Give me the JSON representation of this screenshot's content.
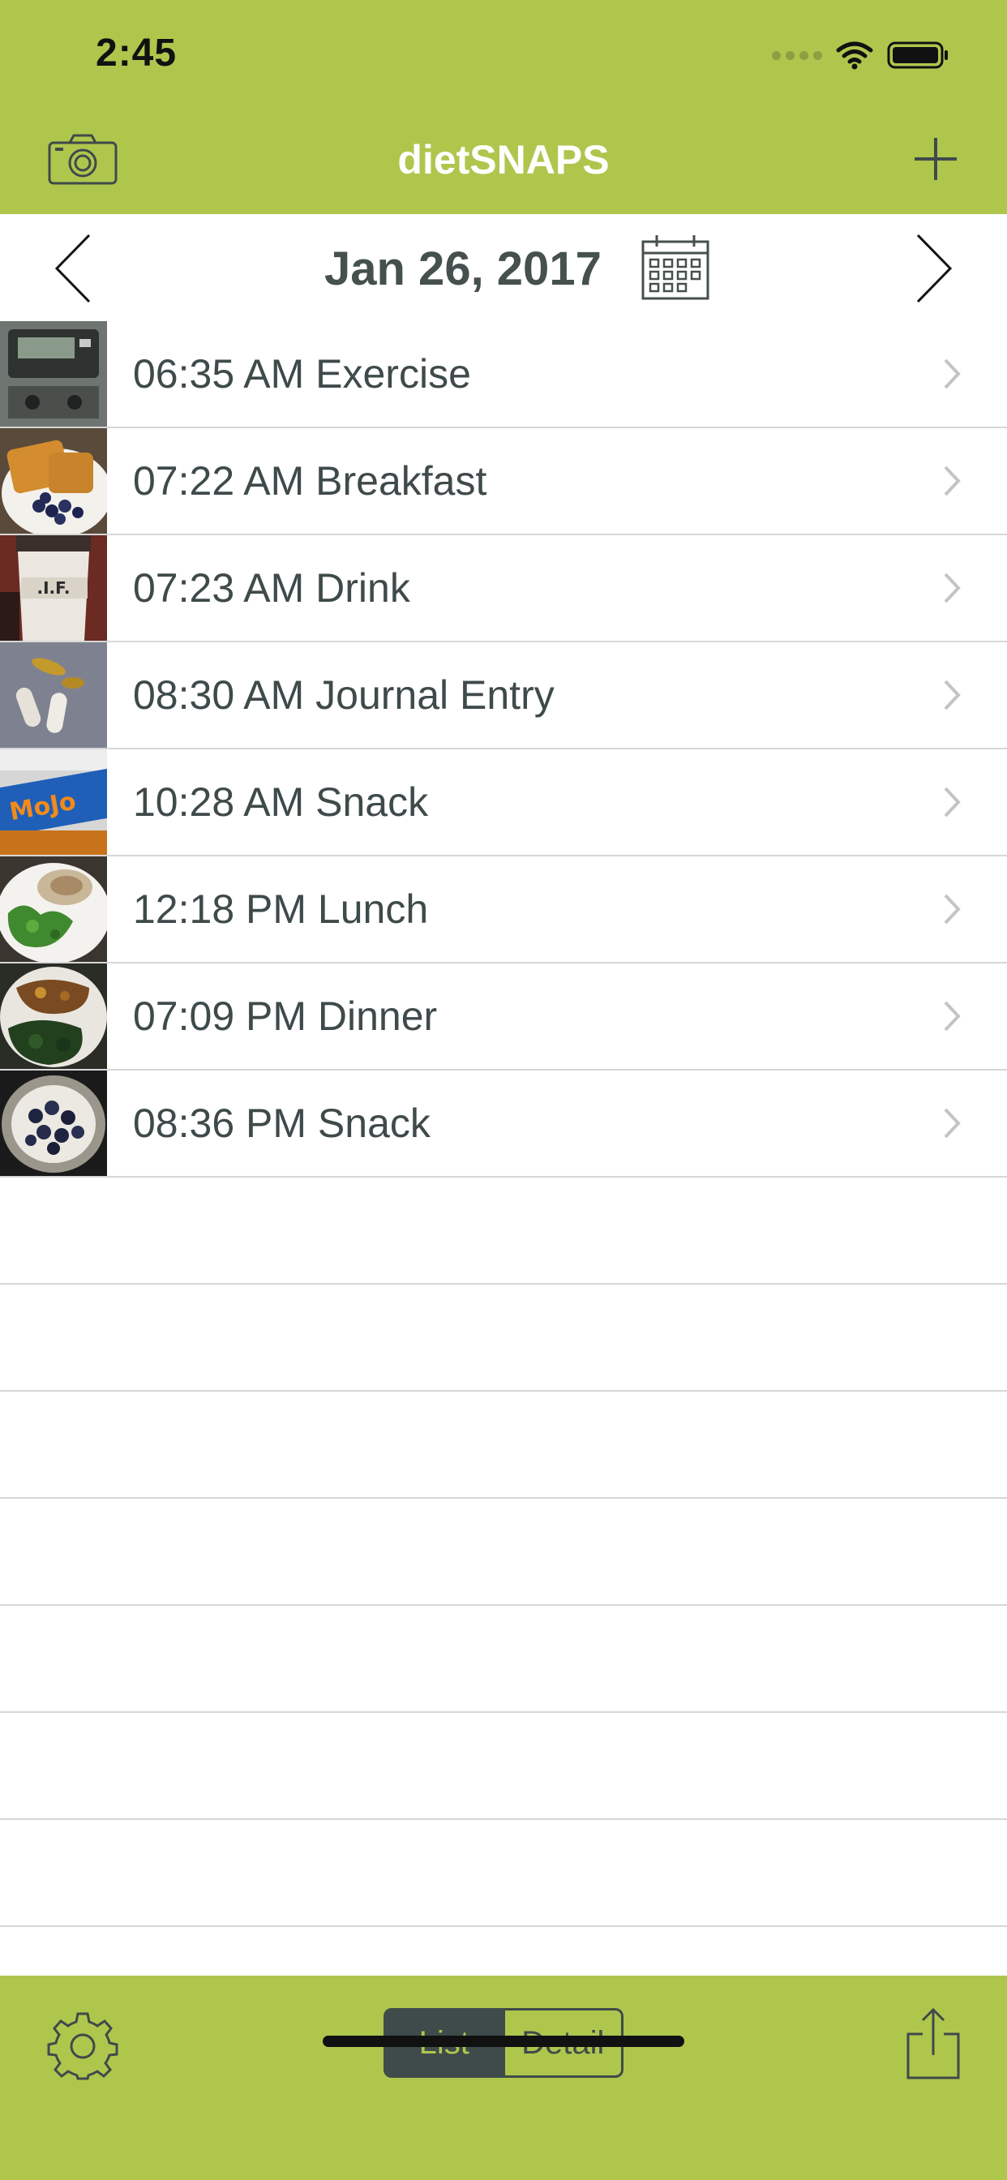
{
  "status_bar": {
    "time": "2:45",
    "icons": [
      "signal-dots-icon",
      "wifi-icon",
      "battery-icon"
    ]
  },
  "header": {
    "title": "dietSNAPS",
    "left_icon": "camera-icon",
    "right_icon": "plus-icon",
    "background_color": "#afc64d"
  },
  "date_bar": {
    "date": "Jan 26, 2017",
    "prev_icon": "chevron-left-icon",
    "next_icon": "chevron-right-icon",
    "calendar_icon": "calendar-icon"
  },
  "entries": [
    {
      "label": "06:35 AM Exercise",
      "thumbnail": "exercise-machine-photo"
    },
    {
      "label": "07:22 AM Breakfast",
      "thumbnail": "bread-and-blueberries-photo"
    },
    {
      "label": "07:23 AM Drink",
      "thumbnail": "coffee-cup-photo"
    },
    {
      "label": "08:30 AM Journal Entry",
      "thumbnail": "supplement-pills-photo"
    },
    {
      "label": "10:28 AM Snack",
      "thumbnail": "snack-bar-photo"
    },
    {
      "label": "12:18 PM Lunch",
      "thumbnail": "salad-wrap-photo"
    },
    {
      "label": "07:09 PM Dinner",
      "thumbnail": "dinner-plate-photo"
    },
    {
      "label": "08:36 PM Snack",
      "thumbnail": "blueberry-bowl-photo"
    }
  ],
  "toolbar": {
    "settings_icon": "gear-icon",
    "view_toggle": {
      "options": [
        "List",
        "Detail"
      ],
      "selected": "List"
    },
    "share_icon": "share-icon"
  },
  "colors": {
    "accent": "#afc64d",
    "text": "#3f4a4a",
    "separator": "#d7d7d7"
  }
}
